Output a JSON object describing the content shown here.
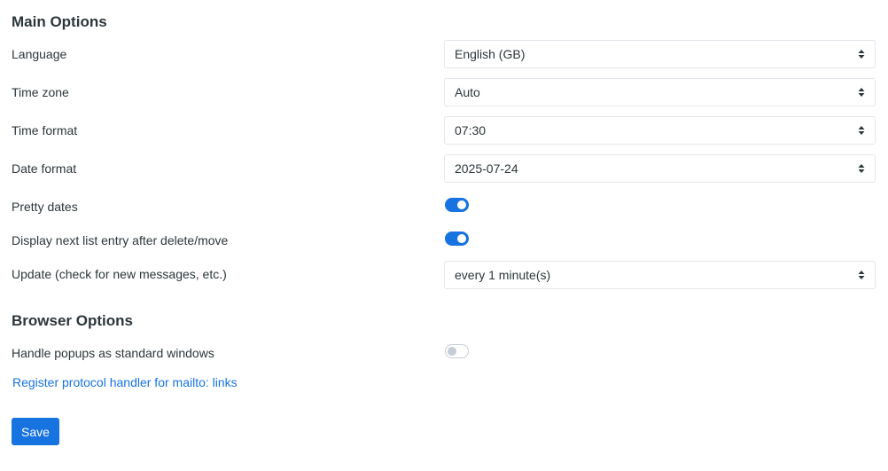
{
  "main_options": {
    "title": "Main Options",
    "language": {
      "label": "Language",
      "value": "English (GB)"
    },
    "timezone": {
      "label": "Time zone",
      "value": "Auto"
    },
    "time_format": {
      "label": "Time format",
      "value": "07:30"
    },
    "date_format": {
      "label": "Date format",
      "value": "2025-07-24"
    },
    "pretty_dates": {
      "label": "Pretty dates",
      "enabled": true
    },
    "display_next": {
      "label": "Display next list entry after delete/move",
      "enabled": true
    },
    "refresh": {
      "label": "Update (check for new messages, etc.)",
      "value": "every 1 minute(s)"
    }
  },
  "browser_options": {
    "title": "Browser Options",
    "standard_windows": {
      "label": "Handle popups as standard windows",
      "enabled": false
    },
    "mailto_link": "Register protocol handler for mailto: links"
  },
  "save_label": "Save",
  "colors": {
    "accent": "#1773e0",
    "text": "#2c363a",
    "border": "#e3e6eb"
  },
  "icons": {
    "select_arrow": "chevron-up-down-icon"
  }
}
